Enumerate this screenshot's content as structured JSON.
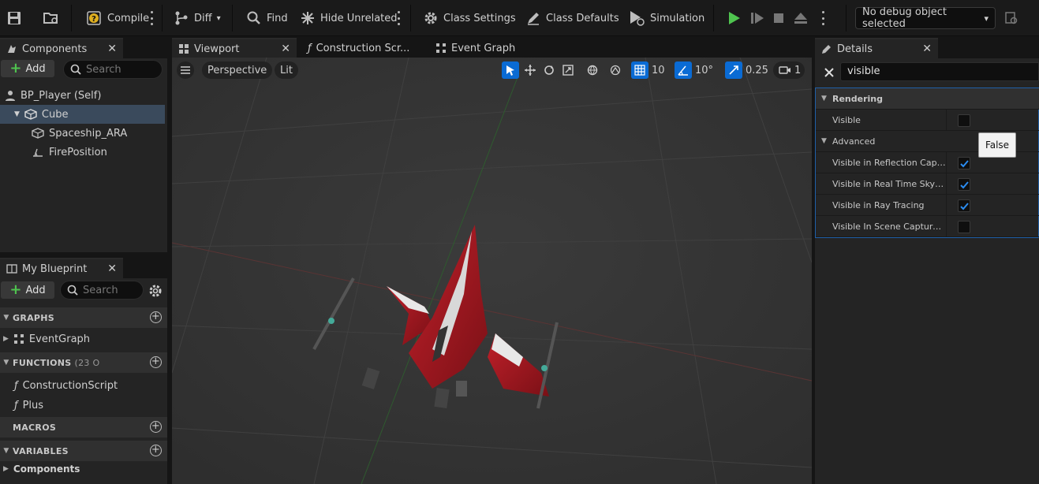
{
  "toolbar": {
    "compile_label": "Compile",
    "diff_label": "Diff",
    "find_label": "Find",
    "hide_unrelated_label": "Hide Unrelated",
    "class_settings_label": "Class Settings",
    "class_defaults_label": "Class Defaults",
    "simulation_label": "Simulation",
    "debug_object": "No debug object selected",
    "play_color": "#4fc44f"
  },
  "components": {
    "tab_label": "Components",
    "add_label": "Add",
    "search_placeholder": "Search",
    "items": [
      {
        "label": "BP_Player (Self)"
      },
      {
        "label": "Cube"
      },
      {
        "label": "Spaceship_ARA"
      },
      {
        "label": "FirePosition"
      }
    ],
    "selected_color": "#3a4a5c"
  },
  "my_blueprint": {
    "tab_label": "My Blueprint",
    "add_label": "Add",
    "search_placeholder": "Search",
    "sections": {
      "graphs": "GRAPHS",
      "functions": "FUNCTIONS",
      "functions_count": "(23 O",
      "macros": "MACROS",
      "variables": "VARIABLES"
    },
    "graphs": [
      "EventGraph"
    ],
    "functions": [
      "ConstructionScript",
      "Plus"
    ],
    "variables": [
      "Components"
    ]
  },
  "editor_tabs": [
    {
      "label": "Viewport"
    },
    {
      "label": "Construction Scr..."
    },
    {
      "label": "Event Graph"
    }
  ],
  "viewport": {
    "perspective_label": "Perspective",
    "lit_label": "Lit",
    "grid_snap": "10",
    "rotation_snap": "10°",
    "scale_snap": "0.25",
    "camera_speed": "1",
    "accent": "#0a6bd4"
  },
  "details": {
    "tab_label": "Details",
    "search_value": "visible",
    "category": "Rendering",
    "subcategory": "Advanced",
    "rows": [
      {
        "label": "Visible",
        "checked": false
      },
      {
        "label": "Visible in Reflection Captur...",
        "checked": true
      },
      {
        "label": "Visible in Real Time Sky C...",
        "checked": true
      },
      {
        "label": "Visible in Ray Tracing",
        "checked": true
      },
      {
        "label": "Visible In Scene Capture O...",
        "checked": false
      }
    ],
    "tooltip": "False",
    "check_color": "#2b8cf0"
  }
}
